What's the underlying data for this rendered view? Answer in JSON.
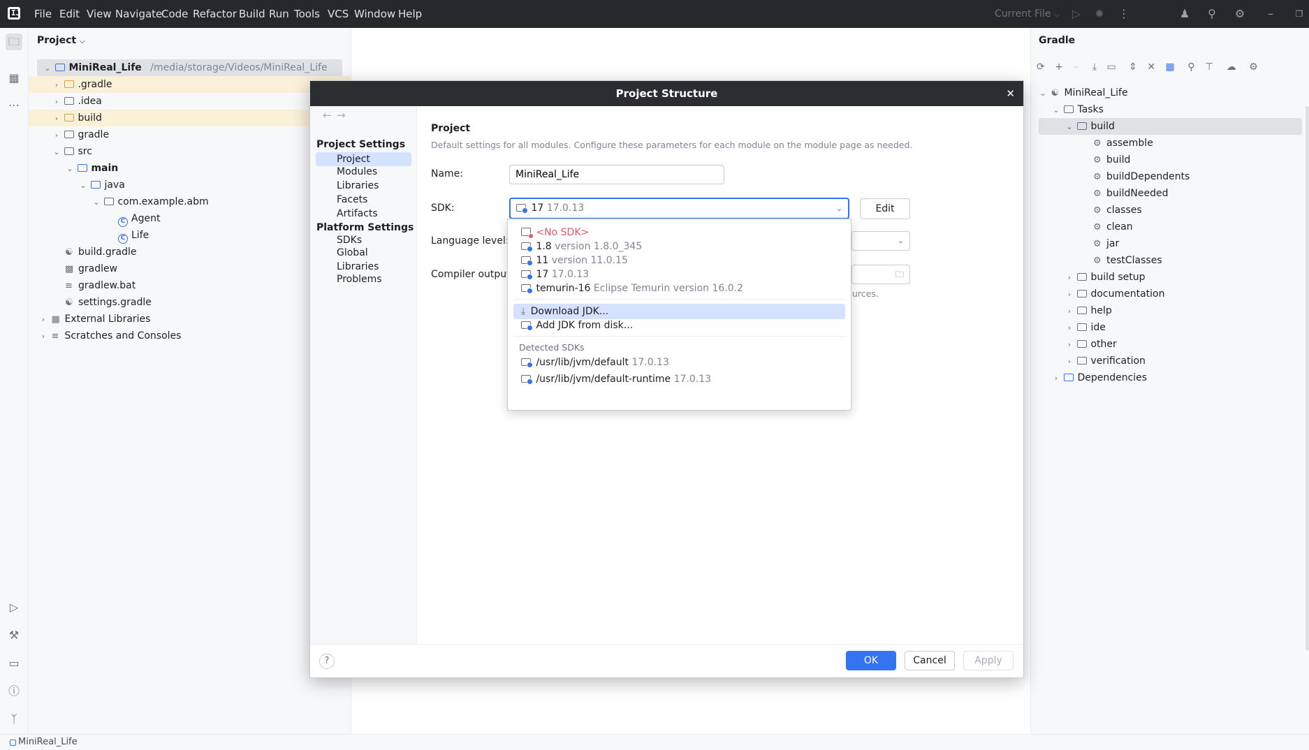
{
  "menu": [
    "File",
    "Edit",
    "View",
    "Navigate",
    "Code",
    "Refactor",
    "Build",
    "Run",
    "Tools",
    "VCS",
    "Window",
    "Help"
  ],
  "toolbar": {
    "run_config": "Current File"
  },
  "project_panel": {
    "title": "Project",
    "root_name": "MiniReal_Life",
    "root_path": "/media/storage/Videos/MiniReal_Life",
    "items": [
      ".gradle",
      ".idea",
      "build",
      "gradle",
      "src",
      "main",
      "java",
      "com.example.abm",
      "Agent",
      "Life",
      "build.gradle",
      "gradlew",
      "gradlew.bat",
      "settings.gradle",
      "External Libraries",
      "Scratches and Consoles"
    ]
  },
  "gradle_panel": {
    "title": "Gradle",
    "root": "MiniReal_Life",
    "tasks": "Tasks",
    "build_group": "build",
    "build_tasks": [
      "assemble",
      "build",
      "buildDependents",
      "buildNeeded",
      "classes",
      "clean",
      "jar",
      "testClasses"
    ],
    "groups": [
      "build setup",
      "documentation",
      "help",
      "ide",
      "other",
      "verification"
    ],
    "dependencies": "Dependencies"
  },
  "status_bar": {
    "project": "MiniReal_Life"
  },
  "dialog": {
    "title": "Project Structure",
    "nav": {
      "project_settings": "Project Settings",
      "project_items": [
        "Project",
        "Modules",
        "Libraries",
        "Facets",
        "Artifacts"
      ],
      "platform_settings": "Platform Settings",
      "platform_items": [
        "SDKs",
        "Global Libraries"
      ],
      "problems": "Problems"
    },
    "content": {
      "heading": "Project",
      "description": "Default settings for all modules. Configure these parameters for each module on the module page as needed.",
      "name_label": "Name:",
      "name_value": "MiniReal_Life",
      "sdk_label": "SDK:",
      "sdk_value_name": "17",
      "sdk_value_version": "17.0.13",
      "edit_button": "Edit",
      "language_level_label": "Language level:",
      "compiler_output_label": "Compiler output:",
      "compiler_hint_tail": "urces."
    },
    "buttons": {
      "ok": "OK",
      "cancel": "Cancel",
      "apply": "Apply",
      "help": "?"
    }
  },
  "sdk_popup": {
    "no_sdk": "<No SDK>",
    "sdks": [
      {
        "name": "1.8",
        "detail": "version 1.8.0_345"
      },
      {
        "name": "11",
        "detail": "version 11.0.15"
      },
      {
        "name": "17",
        "detail": "17.0.13"
      },
      {
        "name": "temurin-16",
        "detail": "Eclipse Temurin version 16.0.2"
      }
    ],
    "download_jdk": "Download JDK...",
    "add_jdk": "Add JDK from disk...",
    "detected_header": "Detected SDKs",
    "detected": [
      {
        "name": "/usr/lib/jvm/default",
        "detail": "17.0.13"
      },
      {
        "name": "/usr/lib/jvm/default-runtime",
        "detail": "17.0.13"
      }
    ]
  },
  "colors": {
    "accent": "#3574f0",
    "titlebar": "#27282c",
    "selection": "#d4e2ff",
    "error": "#e55765"
  }
}
